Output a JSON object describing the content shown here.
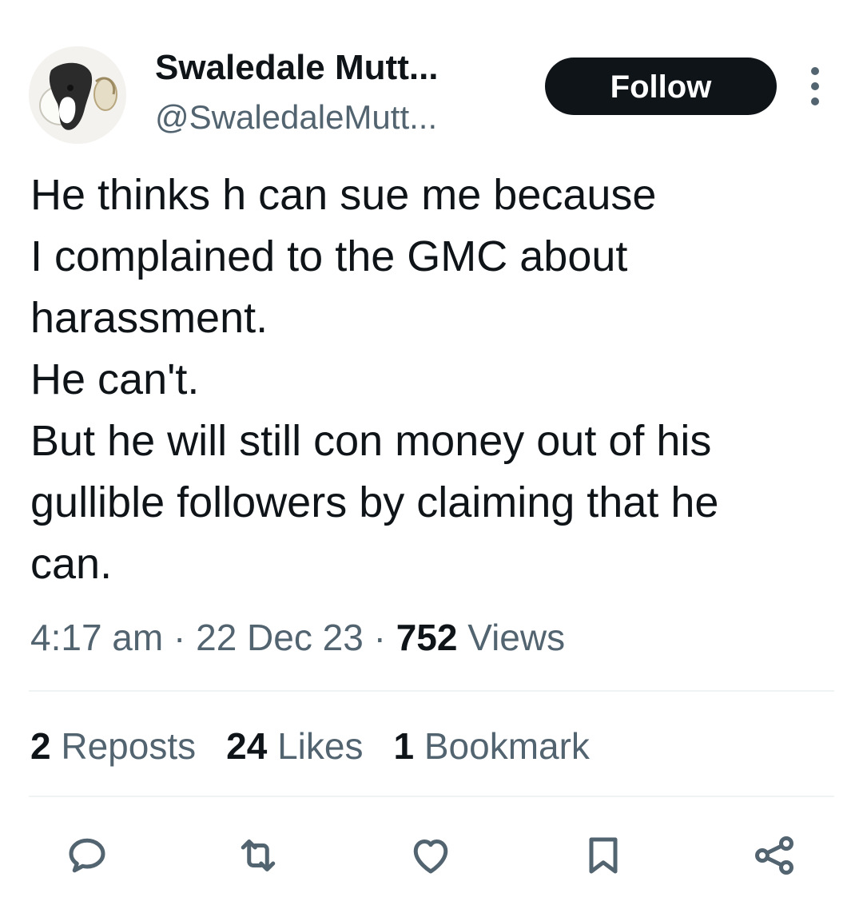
{
  "author": {
    "name": "Swaledale Mutt...",
    "handle": "@SwaledaleMutt...",
    "avatar_icon": "dog-avatar"
  },
  "follow_label": "Follow",
  "tweet": {
    "lines": [
      "He thinks h can sue me because",
      "I complained to the GMC about",
      "harassment.",
      "He can't.",
      "But he will still con money out of his",
      "gullible followers by claiming that he",
      "can."
    ]
  },
  "meta": {
    "time": "4:17 am",
    "sep": "·",
    "date": "22 Dec 23",
    "views_count": "752",
    "views_label": "Views"
  },
  "stats": {
    "reposts_count": "2",
    "reposts_label": "Reposts",
    "likes_count": "24",
    "likes_label": "Likes",
    "bookmarks_count": "1",
    "bookmarks_label": "Bookmark"
  },
  "actions": [
    {
      "icon": "reply-icon"
    },
    {
      "icon": "repost-icon"
    },
    {
      "icon": "like-icon"
    },
    {
      "icon": "bookmark-icon"
    },
    {
      "icon": "share-icon"
    }
  ],
  "colors": {
    "text": "#0f1419",
    "secondary": "#536471",
    "button": "#0f1419",
    "divider": "#eff3f4"
  }
}
